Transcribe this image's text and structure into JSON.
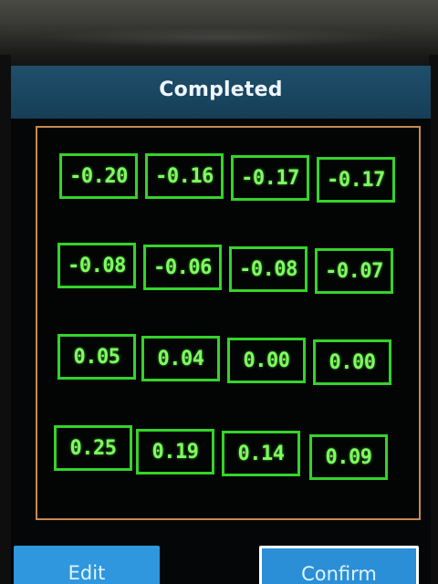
{
  "header": {
    "title": "Completed"
  },
  "grid": {
    "rows": [
      [
        "-0.20",
        "-0.16",
        "-0.17",
        "-0.17"
      ],
      [
        "-0.08",
        "-0.06",
        "-0.08",
        "-0.07"
      ],
      [
        "0.05",
        "0.04",
        "0.00",
        "0.00"
      ],
      [
        "0.25",
        "0.19",
        "0.14",
        "0.09"
      ]
    ]
  },
  "footer": {
    "edit_label": "Edit",
    "confirm_label": "Confirm"
  },
  "colors": {
    "title_bar": "#1f4f6b",
    "grid_border": "#c88a4e",
    "cell_border": "#35d32a",
    "cell_text": "#7dff5e",
    "button": "#2f97dd"
  }
}
